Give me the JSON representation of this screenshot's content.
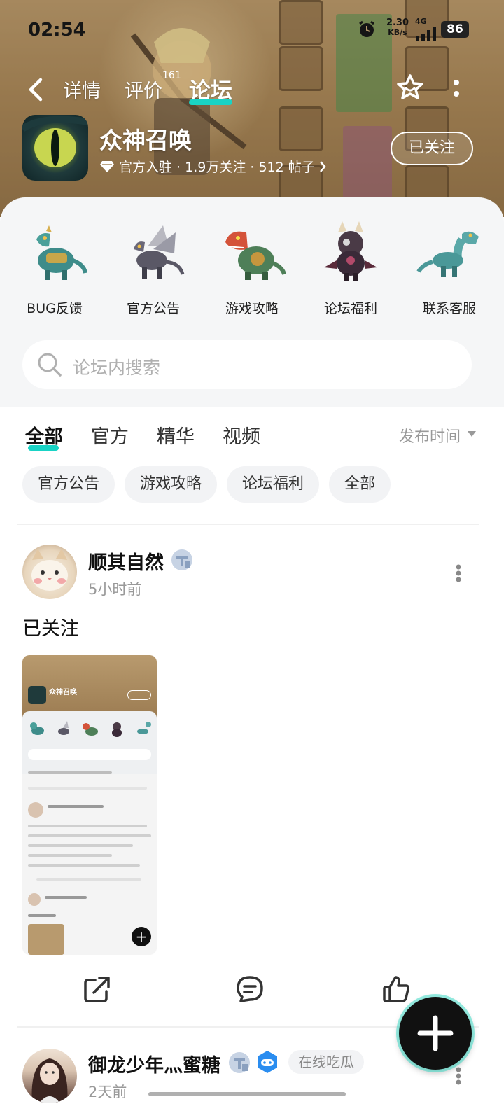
{
  "status_bar": {
    "time": "02:54",
    "speed_value": "2.30",
    "speed_unit": "KB/s",
    "network": "4G",
    "battery": "86"
  },
  "nav": {
    "tabs": [
      {
        "label": "详情"
      },
      {
        "label": "评价"
      },
      {
        "label": "论坛"
      }
    ],
    "review_count": "161",
    "active_tab": "论坛"
  },
  "game": {
    "name": "众神召唤",
    "meta": "官方入驻 · 1.9万关注 · 512 帖子",
    "follow_label": "已关注"
  },
  "shortcuts": [
    {
      "label": "BUG反馈",
      "icon": "teal-armored-dino-icon"
    },
    {
      "label": "官方公告",
      "icon": "winged-dragon-icon"
    },
    {
      "label": "游戏攻略",
      "icon": "red-dino-icon"
    },
    {
      "label": "论坛福利",
      "icon": "dark-horned-creature-icon"
    },
    {
      "label": "联系客服",
      "icon": "blue-dino-icon"
    }
  ],
  "search": {
    "placeholder": "论坛内搜索"
  },
  "filter": {
    "tabs": [
      "全部",
      "官方",
      "精华",
      "视频"
    ],
    "sort_label": "发布时间",
    "chips": [
      "官方公告",
      "游戏攻略",
      "论坛福利",
      "全部"
    ]
  },
  "posts": [
    {
      "author": "顺其自然",
      "time": "5小时前",
      "content": "已关注"
    },
    {
      "author": "御龙少年灬蜜糖",
      "time": "2天前",
      "tag": "在线吃瓜"
    }
  ],
  "colors": {
    "accent": "#19d3c5",
    "hero_bg": "#a58558",
    "panel_bg": "#f5f6f7"
  }
}
